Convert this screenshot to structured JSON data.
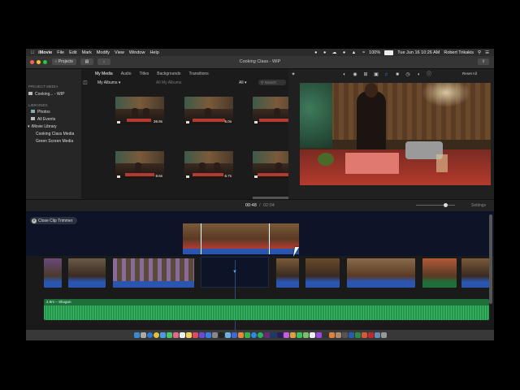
{
  "menubar": {
    "app": "iMovie",
    "items": [
      "File",
      "Edit",
      "Mark",
      "Modify",
      "View",
      "Window",
      "Help"
    ],
    "battery": "100%",
    "datetime": "Tue Jun 16  10:26 AM",
    "user": "Robert Trikakis"
  },
  "titlebar": {
    "projects_button": "Projects",
    "title": "Cooking Class - WIP"
  },
  "sidebar": {
    "project_media_header": "PROJECT MEDIA",
    "project_item": "Cooking... - WIP",
    "libraries_header": "LIBRARIES",
    "photos": "Photos",
    "all_events": "All Events",
    "library": "iMovie Library",
    "event1": "Cooking Class Media",
    "event2": "Green Screen Media"
  },
  "browser": {
    "tabs": [
      "My Media",
      "Audio",
      "Titles",
      "Backgrounds",
      "Transitions"
    ],
    "albums_selector": "My Albums",
    "all_albums": "All My Albums",
    "filter": "All",
    "search_placeholder": "Search",
    "durations": [
      "26.9s",
      "5.0s",
      "8.4s",
      "8.6s",
      "6.7s",
      "17.5s"
    ]
  },
  "viewer": {
    "reset_all": "Reset All"
  },
  "timecode": {
    "current": "00:48",
    "separator": "/",
    "total": "02:04",
    "settings": "Settings"
  },
  "timeline": {
    "close_trimmer": "Close Clip Trimmer",
    "audio_label": "2.9m – Shogun"
  },
  "colors": {
    "accent": "#3b7bd6",
    "audio_green": "#1f6f3a",
    "trimmer_bg": "#0d1428"
  }
}
